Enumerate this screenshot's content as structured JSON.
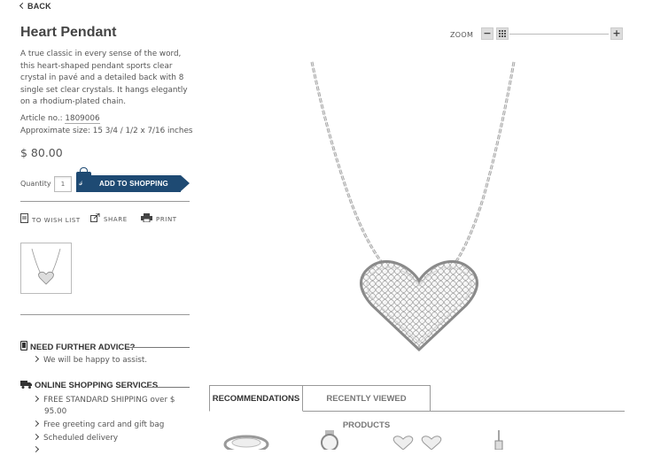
{
  "nav": {
    "back_label": "BACK"
  },
  "product": {
    "title": "Heart Pendant",
    "description": "A true classic in every sense of the word, this heart-shaped pendant sports clear crystal in pavé and a detailed back with 8 single set clear crystals. It hangs elegantly on a rhodium-plated chain.",
    "article_label": "Article no.:",
    "article_number": "1809006",
    "size_text": "Approximate size: 15 3/4 / 1/2 x 7/16 inches",
    "price": "$ 80.00"
  },
  "purchase": {
    "quantity_label": "Quantity",
    "quantity_value": "1",
    "add_to_bag_label": "ADD TO SHOPPING BAG"
  },
  "actions": [
    {
      "label": "TO WISH LIST",
      "icon": "wishlist-icon"
    },
    {
      "label": "SHARE",
      "icon": "share-icon"
    },
    {
      "label": "PRINT",
      "icon": "print-icon"
    }
  ],
  "advice": {
    "heading": "NEED FURTHER ADVICE?",
    "items": [
      "We will be happy to assist."
    ]
  },
  "services": {
    "heading": "ONLINE SHOPPING SERVICES",
    "items": [
      "FREE STANDARD SHIPPING over $",
      "95.00",
      "Free greeting card and gift bag",
      "Scheduled delivery"
    ]
  },
  "zoom": {
    "label": "ZOOM",
    "minus": "−",
    "plus": "+"
  },
  "tabs": [
    {
      "label": "RECOMMENDATIONS",
      "active": true
    },
    {
      "label": "RECENTLY VIEWED PRODUCTS",
      "active": false
    }
  ],
  "colors": {
    "brand_blue": "#1e4a73",
    "text": "#555555"
  }
}
